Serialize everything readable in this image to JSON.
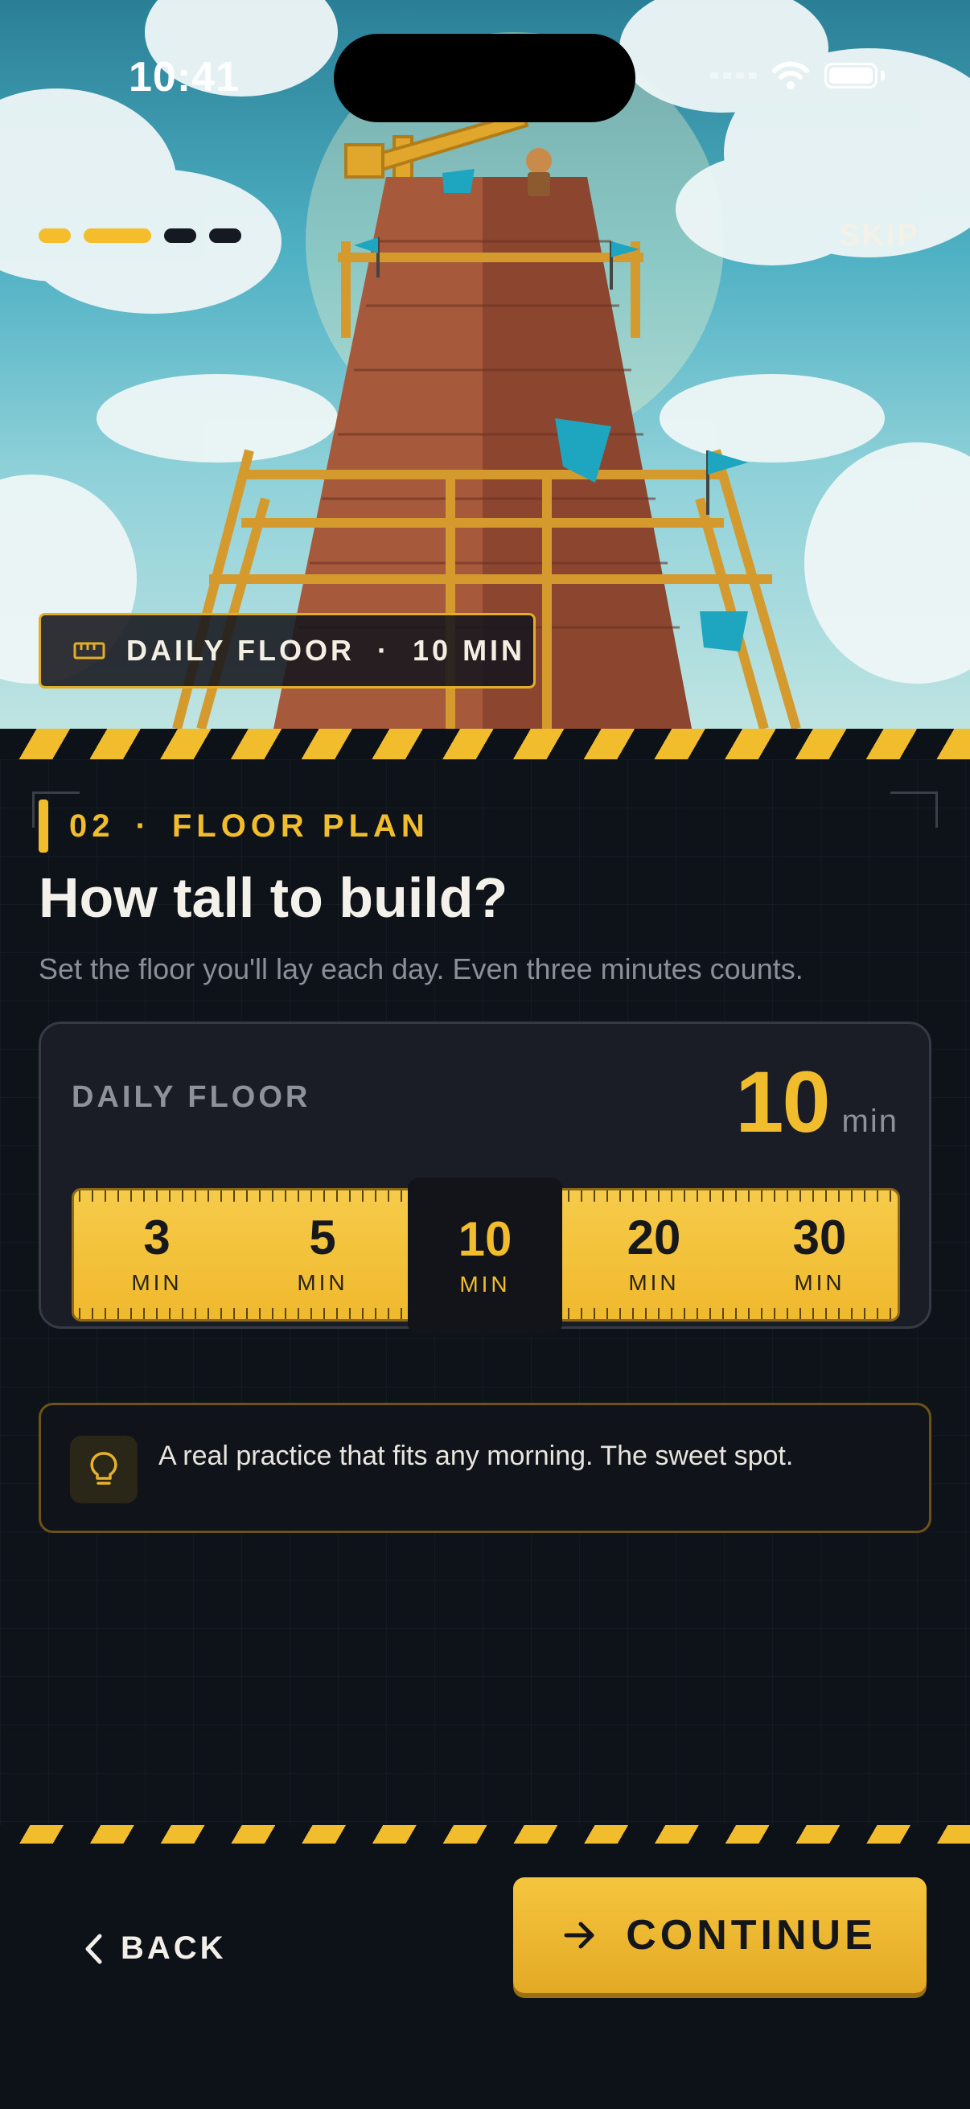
{
  "status_bar": {
    "time": "10:41"
  },
  "onboarding": {
    "steps_total": 4,
    "steps_completed": 2,
    "skip_label": "SKIP"
  },
  "hero": {
    "badge_text": "DAILY FLOOR  ·  10 MIN",
    "icon": "ruler-icon"
  },
  "step": {
    "number": "02",
    "separator": "·",
    "name": "FLOOR PLAN"
  },
  "title": "How tall to build?",
  "subtitle": "Set the floor you'll lay each day. Even three minutes counts.",
  "card": {
    "label": "DAILY FLOOR",
    "value": "10",
    "unit": "min",
    "options": [
      {
        "value": "3",
        "unit": "MIN"
      },
      {
        "value": "5",
        "unit": "MIN"
      },
      {
        "value": "10",
        "unit": "MIN"
      },
      {
        "value": "20",
        "unit": "MIN"
      },
      {
        "value": "30",
        "unit": "MIN"
      }
    ],
    "selected_index": 2
  },
  "tip": {
    "icon": "lightbulb-icon",
    "text": "A real practice that fits any morning. The sweet spot."
  },
  "footer": {
    "back_label": "BACK",
    "continue_label": "CONTINUE"
  },
  "colors": {
    "accent": "#f2bd2c",
    "background": "#0d1118",
    "card": "#1a1d25"
  }
}
